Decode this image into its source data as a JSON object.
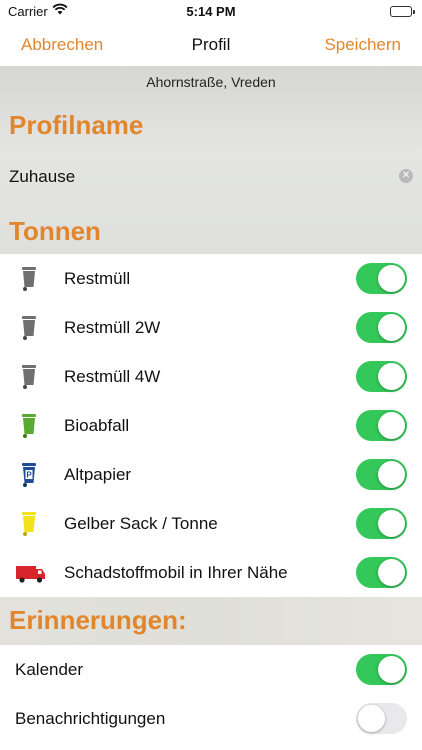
{
  "status_bar": {
    "carrier": "Carrier",
    "time": "5:14 PM"
  },
  "nav": {
    "cancel": "Abbrechen",
    "title": "Profil",
    "save": "Speichern"
  },
  "header": {
    "address": "Ahornstraße, Vreden"
  },
  "profile": {
    "section_title": "Profilname",
    "name_value": "Zuhause",
    "clear_symbol": "✕"
  },
  "bins": {
    "section_title": "Tonnen",
    "items": [
      {
        "label": "Restmüll",
        "icon": "grey-bin-icon",
        "color": "#6f6f6f",
        "enabled": true
      },
      {
        "label": "Restmüll 2W",
        "icon": "grey-bin-icon",
        "color": "#6f6f6f",
        "enabled": true
      },
      {
        "label": "Restmüll 4W",
        "icon": "grey-bin-icon",
        "color": "#6f6f6f",
        "enabled": true
      },
      {
        "label": "Bioabfall",
        "icon": "green-bin-icon",
        "color": "#5aaa2f",
        "enabled": true
      },
      {
        "label": "Altpapier",
        "icon": "blue-paper-bin-icon",
        "color": "#1f4c9a",
        "badge": "P",
        "enabled": true
      },
      {
        "label": "Gelber Sack / Tonne",
        "icon": "yellow-bin-icon",
        "color": "#f2e21a",
        "enabled": true
      },
      {
        "label": "Schadstoffmobil in Ihrer Nähe",
        "icon": "red-truck-icon",
        "color": "#d8242b",
        "enabled": true
      }
    ]
  },
  "reminders": {
    "section_title": "Erinnerungen:",
    "items": [
      {
        "label": "Kalender",
        "enabled": true
      },
      {
        "label": "Benachrichtigungen",
        "enabled": false
      }
    ]
  },
  "colors": {
    "accent": "#e2862e",
    "toggle_on": "#34c759",
    "toggle_off": "#e9e9eb"
  }
}
